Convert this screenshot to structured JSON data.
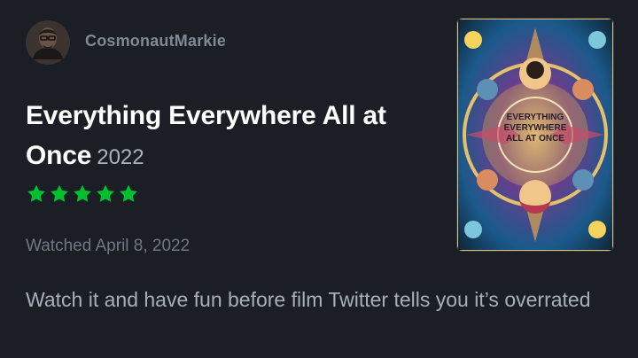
{
  "user": {
    "name": "CosmonautMarkie"
  },
  "film": {
    "title": "Everything Everywhere All at Once",
    "year": "2022"
  },
  "rating": {
    "stars": 5,
    "max_stars": 5,
    "color": "#00c030"
  },
  "watched": {
    "label": "Watched April 8, 2022"
  },
  "review": {
    "text": "Watch it and have fun before film Twitter tells you it’s overrated"
  },
  "poster": {
    "title_line_1": "EVERYTHING",
    "title_line_2": "EVERYWHERE",
    "title_line_3": "ALL AT ONCE"
  },
  "colors": {
    "background": "#1b1e24",
    "title": "#ffffff",
    "username": "#7f8a95",
    "year": "#a9b3bd",
    "watched": "#6f7884",
    "review": "#a6b0bb"
  }
}
